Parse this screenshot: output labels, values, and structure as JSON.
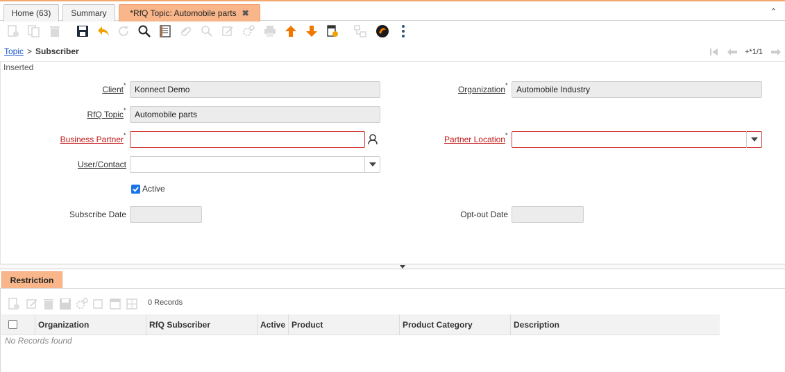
{
  "tabs": [
    {
      "label": "Home (63)"
    },
    {
      "label": "Summary"
    },
    {
      "label": "*RfQ Topic: Automobile parts",
      "active": true
    }
  ],
  "tab_close_glyph": "✖",
  "collapse_glyph": "⌃",
  "toolbar": {
    "icons": [
      "new-icon",
      "copy-icon",
      "delete-icon",
      "save-icon",
      "undo-icon",
      "refresh-icon",
      "find-icon",
      "grid-toggle-icon",
      "attachment-icon",
      "zoom-across-icon",
      "chat-icon",
      "process-icon",
      "print-icon",
      "previous-record-icon",
      "next-record-icon",
      "report-icon",
      "workflow-icon",
      "help-icon",
      "more-icon"
    ]
  },
  "breadcrumb": {
    "parent": "Topic",
    "separator": ">",
    "current": "Subscriber"
  },
  "record_nav": {
    "info": "+*1/1"
  },
  "status": "Inserted",
  "form": {
    "client": {
      "label": "Client",
      "value": "Konnect Demo"
    },
    "organization": {
      "label": "Organization",
      "value": "Automobile Industry"
    },
    "rfq_topic": {
      "label": "RfQ Topic",
      "value": "Automobile parts"
    },
    "business_partner": {
      "label": "Business Partner",
      "value": ""
    },
    "partner_location": {
      "label": "Partner Location",
      "value": ""
    },
    "user_contact": {
      "label": "User/Contact",
      "value": ""
    },
    "active": {
      "label": "Active",
      "checked": true
    },
    "subscribe_date": {
      "label": "Subscribe Date",
      "value": ""
    },
    "opt_out_date": {
      "label": "Opt-out Date",
      "value": ""
    },
    "required_mark": "*"
  },
  "detail": {
    "tab_label": "Restriction",
    "records": "0 Records",
    "columns": [
      "Organization",
      "RfQ Subscriber",
      "Active",
      "Product",
      "Product Category",
      "Description"
    ],
    "empty_message": "No Records found"
  },
  "colors": {
    "accent": "#f8b68a",
    "mandatory": "#c01818",
    "link": "#1a56c8",
    "checkbox": "#1a73e8"
  }
}
